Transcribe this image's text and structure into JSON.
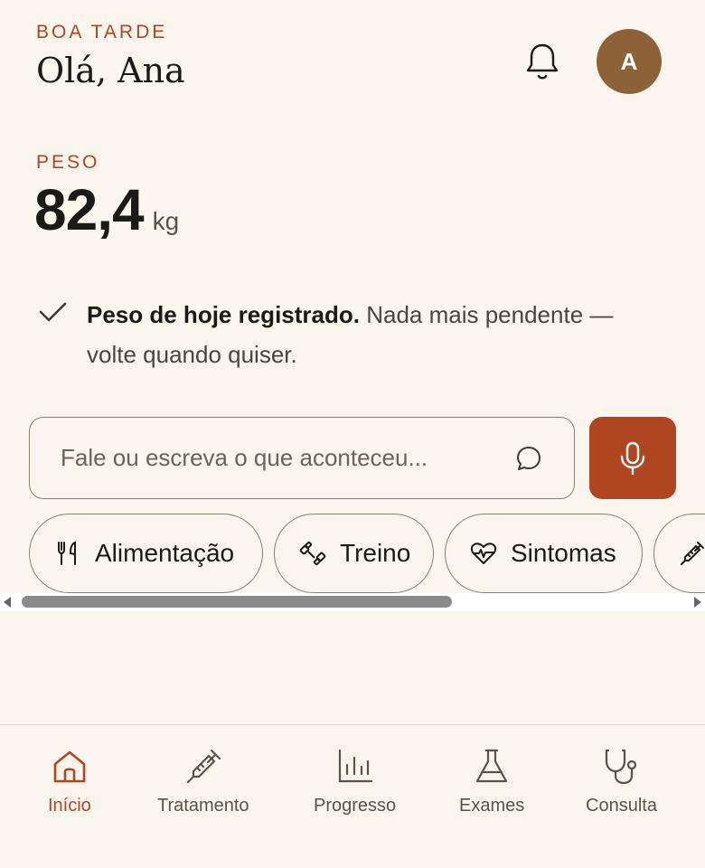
{
  "header": {
    "greeting_label": "BOA TARDE",
    "title": "Olá, Ana",
    "avatar_initial": "A"
  },
  "weight": {
    "label": "PESO",
    "value": "82,4",
    "unit": "kg"
  },
  "status": {
    "bold": "Peso de hoje registrado.",
    "text": " Nada mais pendente — volte quando quiser."
  },
  "input": {
    "placeholder": "Fale ou escreva o que aconteceu..."
  },
  "chips": [
    {
      "label": "Alimentação",
      "icon": "fork-knife-icon"
    },
    {
      "label": "Treino",
      "icon": "dumbbell-icon"
    },
    {
      "label": "Sintomas",
      "icon": "heart-pulse-icon"
    },
    {
      "label": "",
      "icon": "syringe-icon"
    }
  ],
  "nav": [
    {
      "label": "Início",
      "icon": "home-icon",
      "active": true
    },
    {
      "label": "Tratamento",
      "icon": "syringe-icon"
    },
    {
      "label": "Progresso",
      "icon": "bar-chart-icon"
    },
    {
      "label": "Exames",
      "icon": "flask-icon"
    },
    {
      "label": "Consulta",
      "icon": "stethoscope-icon"
    }
  ],
  "colors": {
    "background": "#faf6ee",
    "accent": "#b04522",
    "avatar": "#8e6238",
    "text": "#1c1a17"
  }
}
